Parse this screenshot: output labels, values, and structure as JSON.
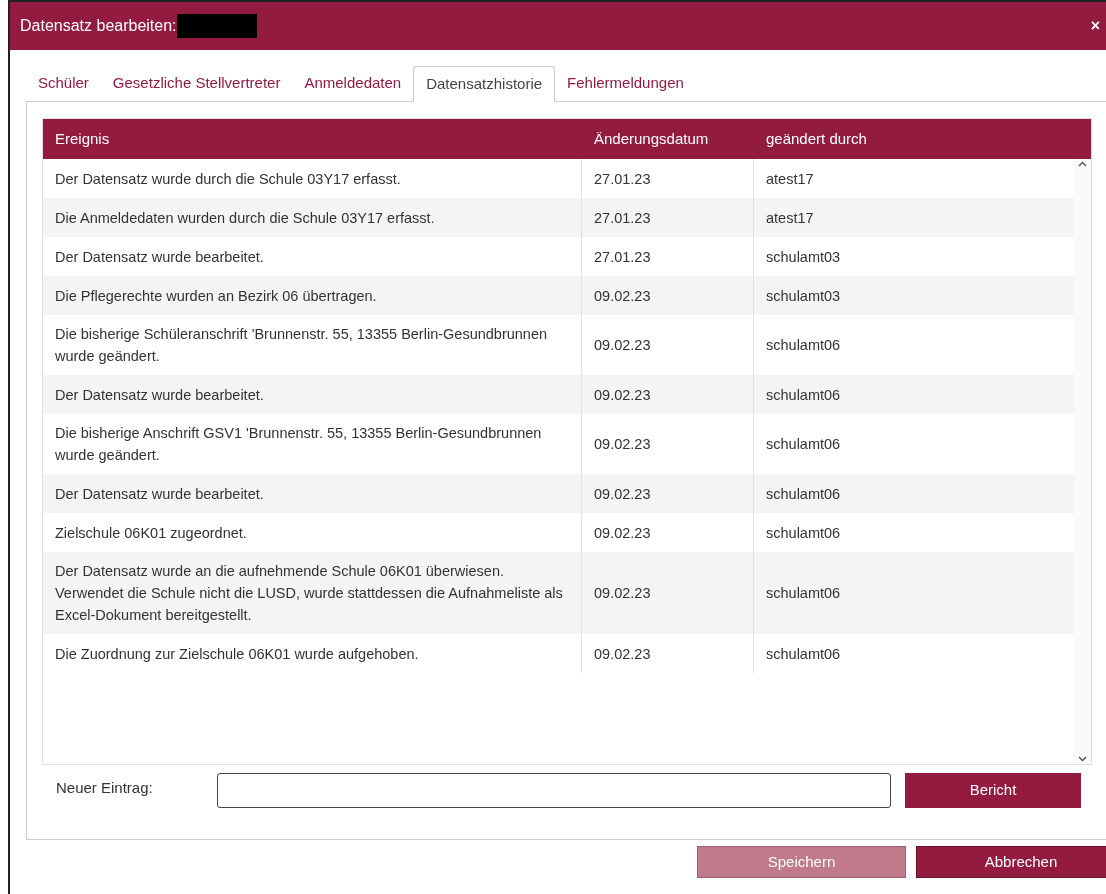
{
  "window": {
    "title": "Datensatz bearbeiten:",
    "redacted": true,
    "close": "×"
  },
  "tabs": [
    {
      "label": "Schüler",
      "selected": false
    },
    {
      "label": "Gesetzliche Stellvertreter",
      "selected": false
    },
    {
      "label": "Anmeldedaten",
      "selected": false
    },
    {
      "label": "Datensatzhistorie",
      "selected": true
    },
    {
      "label": "Fehlermeldungen",
      "selected": false
    }
  ],
  "table": {
    "columns": [
      "Ereignis",
      "Änderungsdatum",
      "geändert durch"
    ],
    "rows": [
      [
        "Der Datensatz wurde durch die Schule 03Y17 erfasst.",
        "27.01.23",
        "atest17"
      ],
      [
        "Die Anmeldedaten wurden durch die Schule 03Y17 erfasst.",
        "27.01.23",
        "atest17"
      ],
      [
        "Der Datensatz wurde bearbeitet.",
        "27.01.23",
        "schulamt03"
      ],
      [
        "Die Pflegerechte wurden an Bezirk 06 übertragen.",
        "09.02.23",
        "schulamt03"
      ],
      [
        "Die bisherige Schüleranschrift 'Brunnenstr. 55, 13355 Berlin-Gesundbrunnen wurde geändert.",
        "09.02.23",
        "schulamt06"
      ],
      [
        "Der Datensatz wurde bearbeitet.",
        "09.02.23",
        "schulamt06"
      ],
      [
        "Die bisherige Anschrift GSV1 'Brunnenstr. 55, 13355 Berlin-Gesundbrunnen wurde geändert.",
        "09.02.23",
        "schulamt06"
      ],
      [
        "Der Datensatz wurde bearbeitet.",
        "09.02.23",
        "schulamt06"
      ],
      [
        "Zielschule 06K01 zugeordnet.",
        "09.02.23",
        "schulamt06"
      ],
      [
        "Der Datensatz wurde an die aufnehmende Schule 06K01 überwiesen. Verwendet die Schule nicht die LUSD, wurde stattdessen die Aufnahmeliste als Excel-Dokument bereitgestellt.",
        "09.02.23",
        "schulamt06"
      ],
      [
        "Die Zuordnung zur Zielschule 06K01 wurde aufgehoben.",
        "09.02.23",
        "schulamt06"
      ]
    ]
  },
  "new_entry": {
    "label": "Neuer Eintrag:",
    "button": "Bericht"
  },
  "buttons": [
    {
      "label": "Speichern",
      "disabled": true
    },
    {
      "label": "Abbrechen",
      "disabled": false
    }
  ]
}
